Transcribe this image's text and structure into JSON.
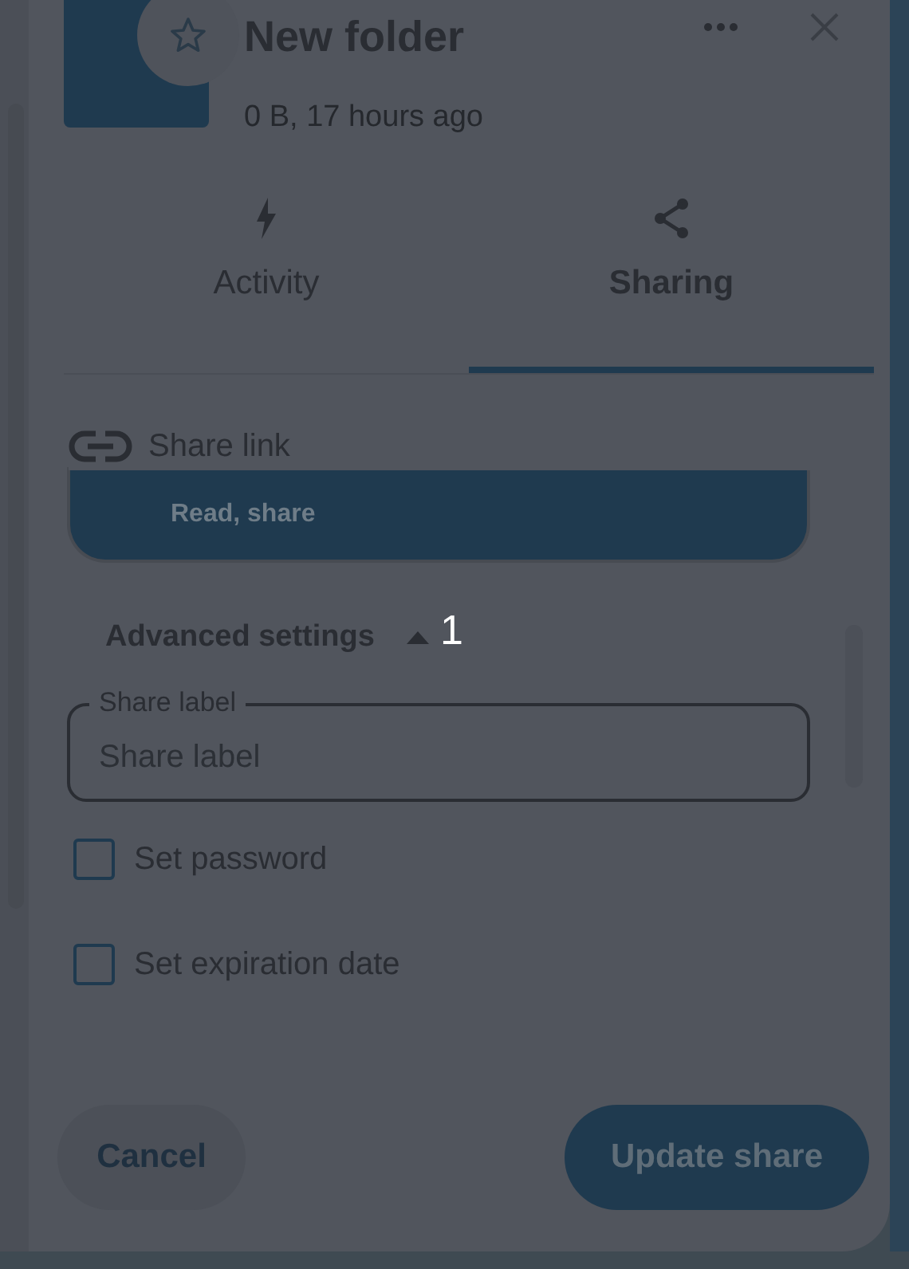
{
  "header": {
    "title": "New folder",
    "subtitle": "0 B, 17 hours ago",
    "favorite": false
  },
  "tabs": [
    {
      "label": "Activity",
      "selected": false
    },
    {
      "label": "Sharing",
      "selected": true
    }
  ],
  "share_link": {
    "label": "Share link"
  },
  "permissions_card": {
    "subtitle": "Read, share"
  },
  "advanced_settings": {
    "label": "Advanced settings",
    "expanded": true,
    "annotation": "1"
  },
  "share_label_field": {
    "label": "Share label",
    "placeholder": "Share label"
  },
  "options": [
    {
      "label": "Set password",
      "checked": false
    },
    {
      "label": "Set expiration date",
      "checked": false
    }
  ],
  "buttons": [
    {
      "label": "Cancel",
      "kind": "secondary"
    },
    {
      "label": "Update share",
      "kind": "primary"
    }
  ]
}
